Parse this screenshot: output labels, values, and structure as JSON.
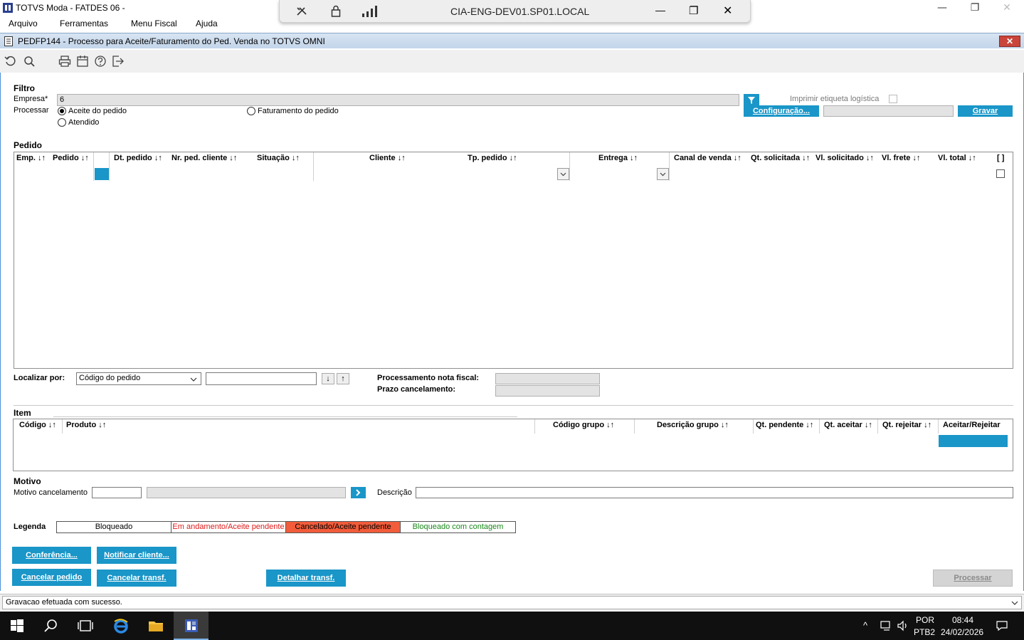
{
  "window": {
    "title": "TOTVS Moda - FATDES 06 -",
    "menu": [
      "Arquivo",
      "Ferramentas",
      "Menu Fiscal",
      "Ajuda"
    ]
  },
  "rdp": {
    "host": "CIA-ENG-DEV01.SP01.LOCAL"
  },
  "form": {
    "title": "PEDFP144 - Processo para Aceite/Faturamento do Ped. Venda no TOTVS OMNI"
  },
  "filtro": {
    "section": "Filtro",
    "empresa_label": "Empresa*",
    "empresa_value": "6",
    "processar_label": "Processar",
    "radio_aceite": "Aceite do pedido",
    "radio_atendido": "Atendido",
    "radio_faturamento": "Faturamento do pedido",
    "imprimir_label": "Imprimir etiqueta logística",
    "configuracao_button": "Configuração...",
    "gravar_button": "Gravar"
  },
  "pedido": {
    "section": "Pedido",
    "columns": [
      "Emp. ↓↑",
      "Pedido ↓↑",
      "Dt. pedido ↓↑",
      "Nr. ped. cliente ↓↑",
      "Situação ↓↑",
      "Cliente ↓↑",
      "Tp. pedido ↓↑",
      "Entrega ↓↑",
      "Canal de venda ↓↑",
      "Qt. solicitada ↓↑",
      "Vl. solicitado ↓↑",
      "Vl. frete ↓↑",
      "Vl. total ↓↑",
      "[ ]"
    ]
  },
  "localizar": {
    "label": "Localizar por:",
    "select_value": "Código do pedido",
    "proc_nf_label": "Processamento nota fiscal:",
    "prazo_label": "Prazo cancelamento:"
  },
  "item": {
    "section": "Item",
    "columns": [
      "Código ↓↑",
      "Produto ↓↑",
      "Código grupo ↓↑",
      "Descrição grupo ↓↑",
      "Qt. pendente ↓↑",
      "Qt. aceitar ↓↑",
      "Qt. rejeitar ↓↑",
      "Aceitar/Rejeitar"
    ]
  },
  "motivo": {
    "section": "Motivo",
    "motivo_label": "Motivo cancelamento",
    "descricao_label": "Descrição"
  },
  "legenda": {
    "label": "Legenda",
    "items": [
      "Bloqueado",
      "Em andamento/Aceite pendente",
      "Cancelado/Aceite pendente",
      "Bloqueado com contagem"
    ],
    "colors": [
      "#000000",
      "#e01b1b",
      "#000000",
      "#1a8a1a"
    ],
    "backgrounds": [
      "#ffffff",
      "#ffffff",
      "#f25c3a",
      "#ffffff"
    ]
  },
  "buttons": {
    "conferencia": "Conferência...",
    "notificar": "Notificar cliente...",
    "cancelar_pedido": "Cancelar pedido",
    "cancelar_transf": "Cancelar transf.",
    "detalhar_transf": "Detalhar transf.",
    "processar": "Processar"
  },
  "status": {
    "message": "Gravacao efetuada com sucesso."
  },
  "taskbar": {
    "lang1": "POR",
    "lang2": "PTB2",
    "time": "08:44",
    "date": "24/02/2026"
  }
}
